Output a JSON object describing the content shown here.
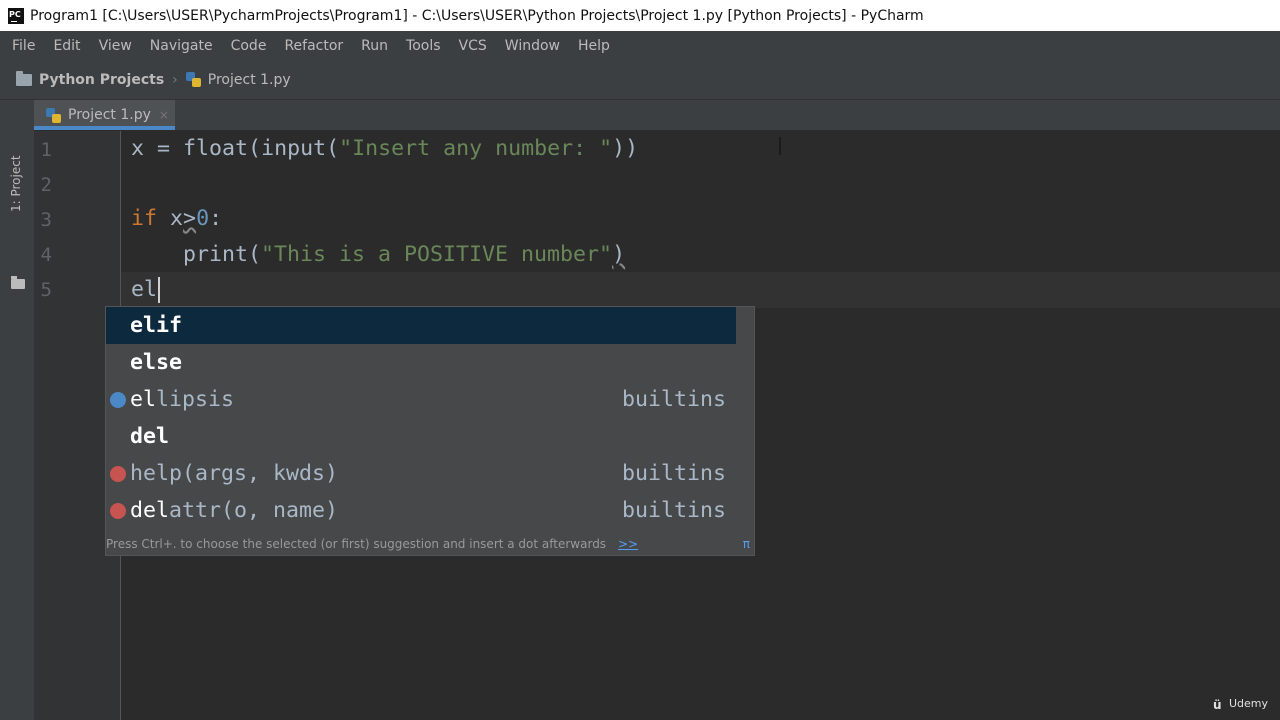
{
  "window": {
    "title": "Program1 [C:\\Users\\USER\\PycharmProjects\\Program1] - C:\\Users\\USER\\Python Projects\\Project 1.py [Python Projects] - PyCharm"
  },
  "menu": {
    "items": [
      "File",
      "Edit",
      "View",
      "Navigate",
      "Code",
      "Refactor",
      "Run",
      "Tools",
      "VCS",
      "Window",
      "Help"
    ]
  },
  "navbar": {
    "project": "Python Projects",
    "file": "Project 1.py",
    "separator": "›"
  },
  "toolstrip": {
    "project_label": "1: Project"
  },
  "tab": {
    "label": "Project 1.py",
    "close": "×"
  },
  "editor": {
    "line_numbers": [
      "1",
      "2",
      "3",
      "4",
      "5"
    ],
    "lines": {
      "l1": {
        "x": "x",
        "eq": " = ",
        "float": "float",
        "p1": "(",
        "input": "input",
        "p2": "(",
        "string": "\"Insert any number: \"",
        "close": "))"
      },
      "l3": {
        "if": "if",
        "sp": " ",
        "x": "x",
        "gt": ">",
        "zero": "0",
        "colon": ":"
      },
      "l4": {
        "indent": "    ",
        "print": "print",
        "p1": "(",
        "string": "\"This is a POSITIVE number\"",
        "p2": ")"
      },
      "l5": {
        "typed": "el"
      }
    }
  },
  "completion": {
    "items": [
      {
        "match": "el",
        "rest": "if",
        "source": ""
      },
      {
        "match": "el",
        "rest": "se",
        "source": ""
      },
      {
        "match": "el",
        "rest": "lipsis",
        "source": "builtins"
      },
      {
        "match": "del",
        "rest": "",
        "source": ""
      },
      {
        "match": "",
        "rest": "help(args, kwds)",
        "source": "builtins"
      },
      {
        "match": "del",
        "rest": "attr(o, name)",
        "source": "builtins"
      }
    ],
    "hint": "Press Ctrl+. to choose the selected (or first) suggestion and insert a dot afterwards",
    "hint_link": ">>",
    "pi": "π"
  },
  "watermark": {
    "brand": "Udemy"
  },
  "colors": {
    "keyword": "#cc7832",
    "string": "#6a8759",
    "number": "#6897bb",
    "text": "#a9b7c6",
    "selection": "#0d293e",
    "tab_underline": "#4a88c7"
  }
}
